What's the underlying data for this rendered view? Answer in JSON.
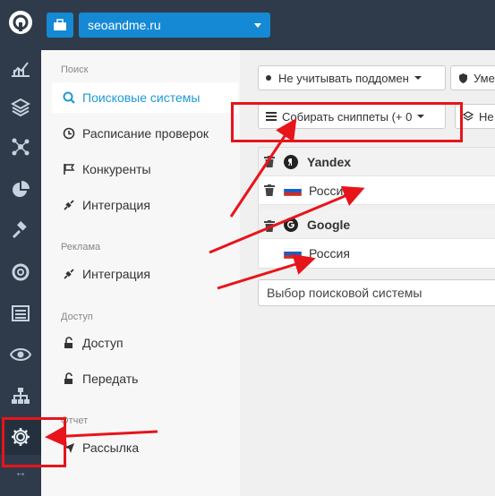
{
  "topbar": {
    "project_name": "seoandme.ru"
  },
  "rail": {
    "icons": [
      "logo-icon",
      "chart-icon",
      "layers-icon",
      "network-icon",
      "pie-chart-icon",
      "gavel-icon",
      "lifebuoy-icon",
      "list-icon",
      "eye-icon",
      "sitemap-icon",
      "gear-icon"
    ],
    "collapse_glyph": "↔"
  },
  "menu": {
    "sections": [
      {
        "title": "Поиск",
        "items": [
          "Поисковые системы",
          "Расписание проверок",
          "Конкуренты",
          "Интеграция"
        ]
      },
      {
        "title": "Реклама",
        "items": [
          "Интеграция"
        ]
      },
      {
        "title": "Доступ",
        "items": [
          "Доступ",
          "Передать"
        ]
      },
      {
        "title": "Отчет",
        "items": [
          "Рассылка"
        ]
      }
    ]
  },
  "content": {
    "subdomain_select": "Не учитывать поддомен",
    "second_select": "Уме",
    "snippets_select": "Собирать сниппеты (+ 0",
    "fourth_select": "Не",
    "engines": [
      {
        "name": "Yandex",
        "regions": [
          "Россия"
        ]
      },
      {
        "name": "Google",
        "regions": [
          "Россия"
        ]
      }
    ],
    "engine_select_placeholder": "Выбор поисковой системы"
  },
  "colors": {
    "rail_bg": "#2f3b4a",
    "accent": "#1589d4",
    "active_text": "#1e9ad6",
    "annotation": "#e8141b"
  }
}
